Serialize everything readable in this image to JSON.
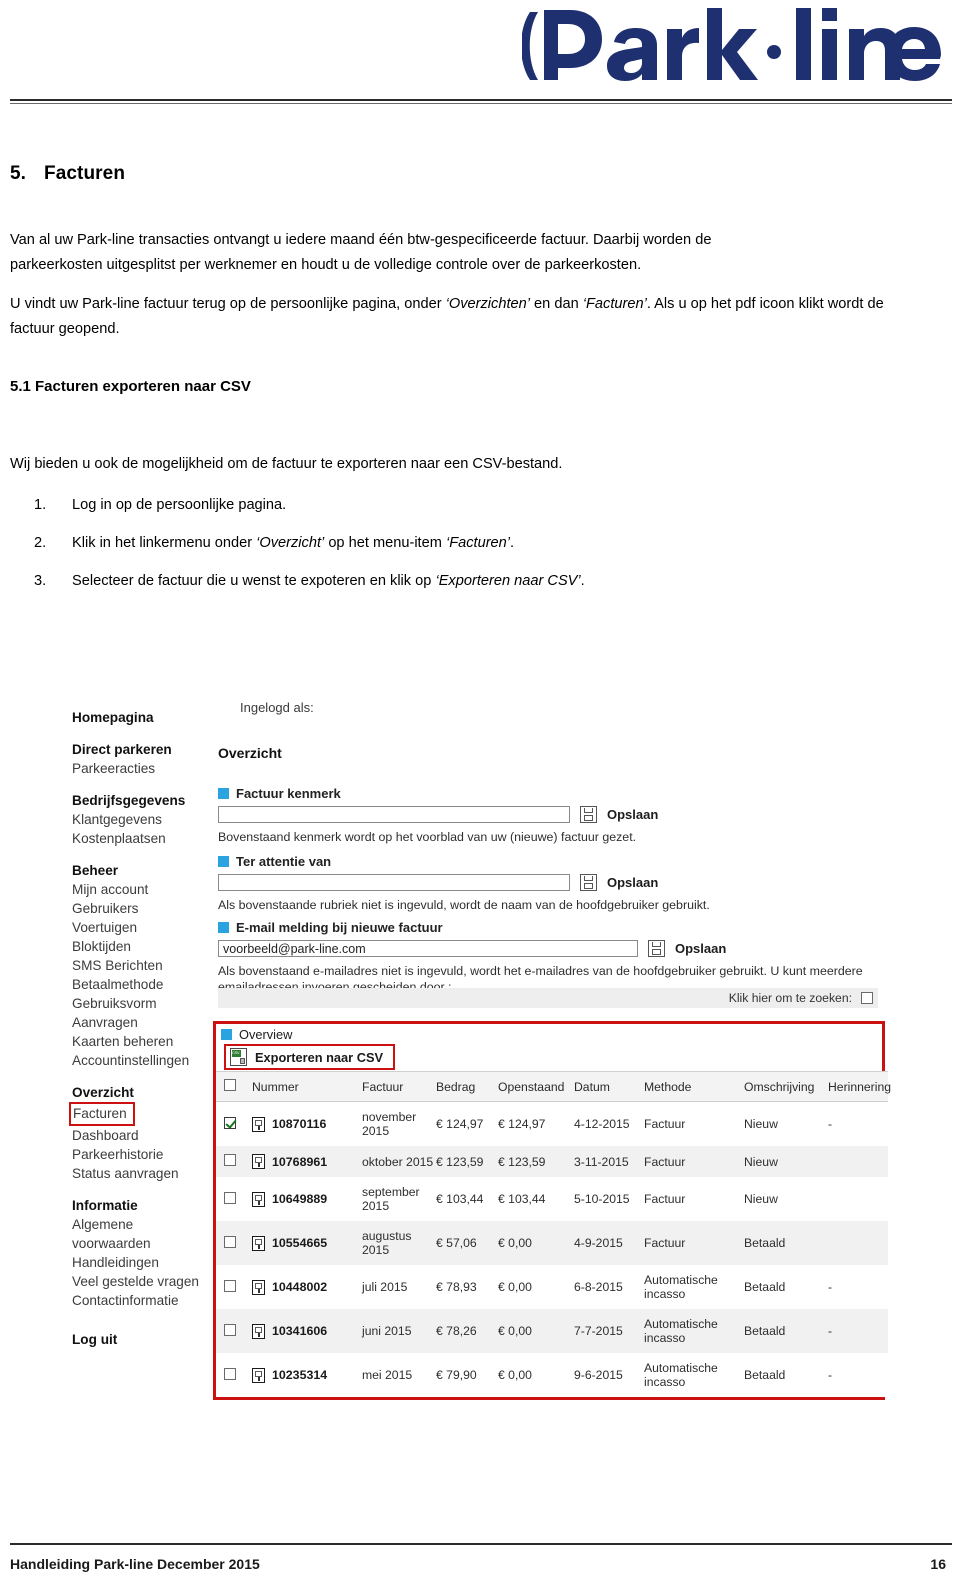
{
  "header": {
    "logo_text": "Park·line",
    "logo_color": "#1f3070"
  },
  "document": {
    "section_number": "5.",
    "section_title": "Facturen",
    "para1_a": "Van al uw Park-line transacties ontvangt u iedere maand één btw-gespecificeerde factuur. Daarbij worden de",
    "para1_b": "parkeerkosten uitgesplitst per werknemer en houdt u de volledige controle over de parkeerkosten.",
    "para2_a": "U vindt uw Park-line factuur terug op de persoonlijke pagina, onder ",
    "para2_em1": "‘Overzichten’",
    "para2_b": " en dan ",
    "para2_em2": "‘Facturen’",
    "para2_c": ". Als u op het",
    "para2_d": "pdf icoon klikt wordt de factuur geopend.",
    "subsection_title": "5.1 Facturen exporteren naar CSV",
    "para3": "Wij bieden u ook de mogelijkheid om de factuur te exporteren naar een CSV-bestand.",
    "steps": [
      {
        "marker": "1.",
        "text": "Log in op de persoonlijke pagina."
      },
      {
        "marker": "2.",
        "pre": "Klik in het linkermenu onder ",
        "em1": "‘Overzicht’",
        "mid": " op het menu-item ",
        "em2": "‘Facturen’",
        "post": "."
      },
      {
        "marker": "3.",
        "pre": "Selecteer de factuur die u wenst te expoteren en klik op ",
        "em1": "‘Exporteren naar CSV’",
        "post": "."
      }
    ]
  },
  "app": {
    "sidebar": {
      "groups": [
        {
          "title": "Homepagina",
          "items": []
        },
        {
          "title": "Direct parkeren",
          "items": [
            "Parkeeracties"
          ]
        },
        {
          "title": "Bedrijfsgegevens",
          "items": [
            "Klantgegevens",
            "Kostenplaatsen"
          ]
        },
        {
          "title": "Beheer",
          "items": [
            "Mijn account",
            "Gebruikers",
            "Voertuigen",
            "Bloktijden",
            "SMS Berichten",
            "Betaalmethode",
            "Gebruiksvorm",
            "Aanvragen",
            "Kaarten beheren",
            "Accountinstellingen"
          ]
        },
        {
          "title": "Overzicht",
          "items": [
            "Facturen",
            "Dashboard",
            "Parkeerhistorie",
            "Status aanvragen"
          ]
        },
        {
          "title": "Informatie",
          "items": [
            "Algemene",
            "voorwaarden",
            "Handleidingen",
            "Veel gestelde vragen",
            "Contactinformatie"
          ]
        }
      ],
      "selected_item": "Facturen",
      "logout": "Log uit"
    },
    "panel": {
      "logged_in_label": "Ingelogd als:",
      "overview_heading": "Overzicht",
      "fields": [
        {
          "label": "Factuur kenmerk",
          "value": "",
          "save_label": "Opslaan",
          "note": "Bovenstaand kenmerk wordt op het voorblad van uw (nieuwe) factuur gezet."
        },
        {
          "label": "Ter attentie van",
          "value": "",
          "save_label": "Opslaan",
          "note": "Als bovenstaande rubriek niet is ingevuld, wordt de naam van de hoofdgebruiker gebruikt."
        },
        {
          "label": "E-mail melding bij nieuwe factuur",
          "value": "voorbeeld@park-line.com",
          "save_label": "Opslaan",
          "note": "Als bovenstaand e-mailadres niet is ingevuld, wordt het e-mailadres van de hoofdgebruiker gebruikt. U kunt meerdere emailadressen invoeren gescheiden door ;"
        }
      ],
      "search_label": "Klik hier om te zoeken:",
      "overview_block_label": "Overview",
      "export_label": "Exporteren naar CSV",
      "table": {
        "columns": [
          "Nummer",
          "Factuur",
          "Bedrag",
          "Openstaand",
          "Datum",
          "Methode",
          "Omschrijving",
          "Herinnering"
        ],
        "rows": [
          {
            "selected": true,
            "nummer": "10870116",
            "factuur": "november 2015",
            "bedrag": "€ 124,97",
            "openstaand": "€ 124,97",
            "datum": "4-12-2015",
            "methode": "Factuur",
            "omschrijving": "Nieuw",
            "herinnering": "-"
          },
          {
            "selected": false,
            "nummer": "10768961",
            "factuur": "oktober 2015",
            "bedrag": "€ 123,59",
            "openstaand": "€ 123,59",
            "datum": "3-11-2015",
            "methode": "Factuur",
            "omschrijving": "Nieuw",
            "herinnering": ""
          },
          {
            "selected": false,
            "nummer": "10649889",
            "factuur": "september 2015",
            "bedrag": "€ 103,44",
            "openstaand": "€ 103,44",
            "datum": "5-10-2015",
            "methode": "Factuur",
            "omschrijving": "Nieuw",
            "herinnering": ""
          },
          {
            "selected": false,
            "nummer": "10554665",
            "factuur": "augustus 2015",
            "bedrag": "€ 57,06",
            "openstaand": "€ 0,00",
            "datum": "4-9-2015",
            "methode": "Factuur",
            "omschrijving": "Betaald",
            "herinnering": ""
          },
          {
            "selected": false,
            "nummer": "10448002",
            "factuur": "juli 2015",
            "bedrag": "€ 78,93",
            "openstaand": "€ 0,00",
            "datum": "6-8-2015",
            "methode": "Automatische incasso",
            "omschrijving": "Betaald",
            "herinnering": "-"
          },
          {
            "selected": false,
            "nummer": "10341606",
            "factuur": "juni 2015",
            "bedrag": "€ 78,26",
            "openstaand": "€ 0,00",
            "datum": "7-7-2015",
            "methode": "Automatische incasso",
            "omschrijving": "Betaald",
            "herinnering": "-"
          },
          {
            "selected": false,
            "nummer": "10235314",
            "factuur": "mei 2015",
            "bedrag": "€ 79,90",
            "openstaand": "€ 0,00",
            "datum": "9-6-2015",
            "methode": "Automatische incasso",
            "omschrijving": "Betaald",
            "herinnering": "-"
          }
        ]
      }
    }
  },
  "footer": {
    "text": "Handleiding Park-line December 2015",
    "page": "16"
  }
}
